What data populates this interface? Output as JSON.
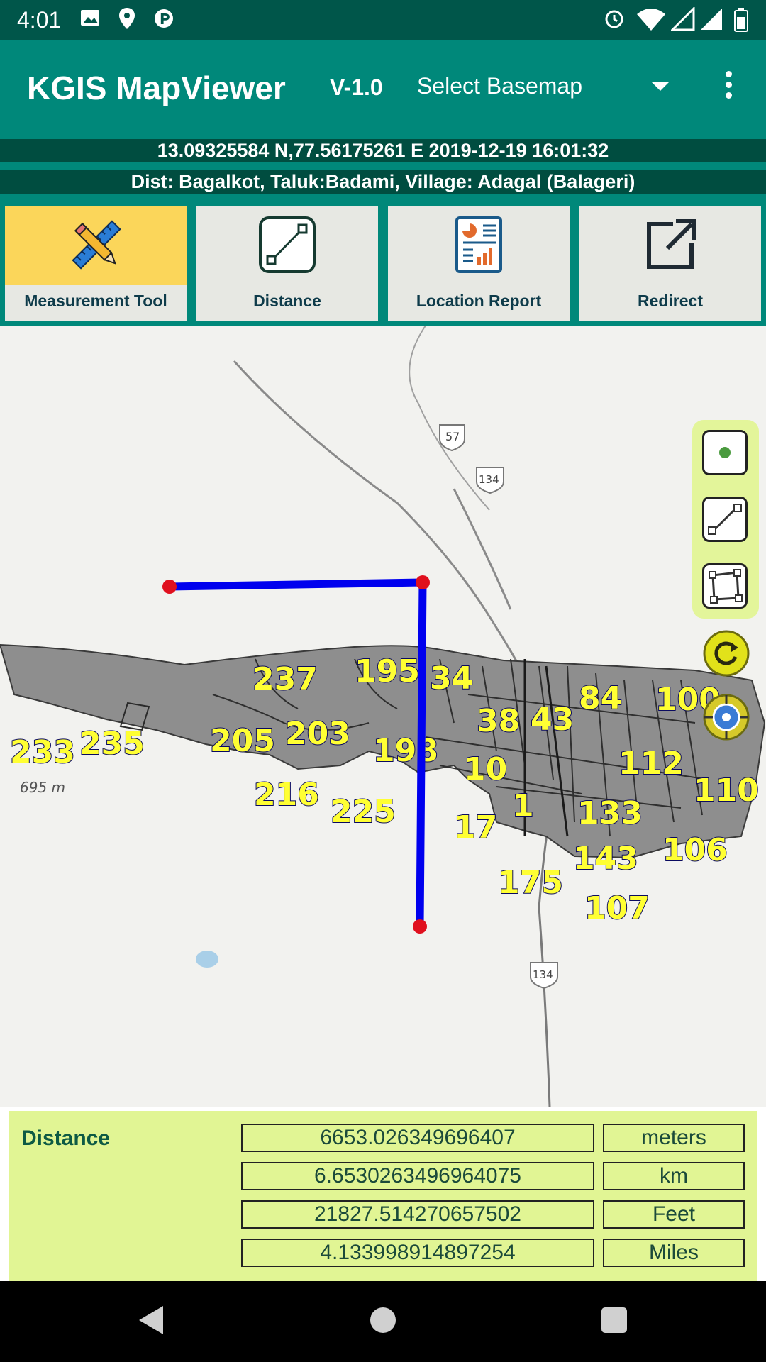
{
  "status_bar": {
    "time": "4:01",
    "left_icons": [
      "image-icon",
      "location-pin-icon",
      "parking-icon"
    ],
    "right_icons": [
      "alarm-icon",
      "wifi-icon",
      "signal-icon",
      "signal-icon",
      "battery-icon"
    ]
  },
  "app_bar": {
    "title": "KGIS MapViewer",
    "version": "V-1.0",
    "basemap_select": "Select Basemap",
    "menu_icon": "more-vert-icon"
  },
  "info": {
    "coordinates": "13.09325584 N,77.56175261 E  2019-12-19 16:01:32",
    "location": "Dist: Bagalkot, Taluk:Badami,  Village: Adagal (Balageri)"
  },
  "tools": [
    {
      "label": "Measurement Tool",
      "icon": "pencil-ruler-icon",
      "active": true
    },
    {
      "label": "Distance",
      "icon": "line-measure-icon",
      "active": false
    },
    {
      "label": "Location Report",
      "icon": "report-chart-icon",
      "active": false
    },
    {
      "label": "Redirect",
      "icon": "external-link-icon",
      "active": false
    }
  ],
  "map": {
    "scale_text": "695 m",
    "road_shields": [
      "57",
      "134",
      "134"
    ],
    "parcel_labels": [
      "237",
      "195",
      "34",
      "84",
      "100",
      "233",
      "235",
      "205",
      "203",
      "198",
      "38",
      "43",
      "10",
      "112",
      "110",
      "216",
      "225",
      "1",
      "133",
      "17",
      "143",
      "106",
      "175",
      "107"
    ],
    "right_tools": [
      "point-icon",
      "line-icon",
      "polygon-icon"
    ],
    "refresh_icon": "refresh-icon",
    "gps_icon": "gps-locate-icon",
    "colors": {
      "measure_line": "#0000ee",
      "vertex": "#e0101e",
      "parcel_fill": "#8e8e8e",
      "label_fill": "#ffff33"
    }
  },
  "distance_panel": {
    "heading": "Distance",
    "rows": [
      {
        "value": "6653.026349696407",
        "unit": "meters"
      },
      {
        "value": "6.6530263496964075",
        "unit": "km"
      },
      {
        "value": "21827.514270657502",
        "unit": "Feet"
      },
      {
        "value": "4.133998914897254",
        "unit": "Miles"
      }
    ]
  },
  "nav_bar": {
    "icons": [
      "back-icon",
      "home-icon",
      "recents-icon"
    ]
  }
}
